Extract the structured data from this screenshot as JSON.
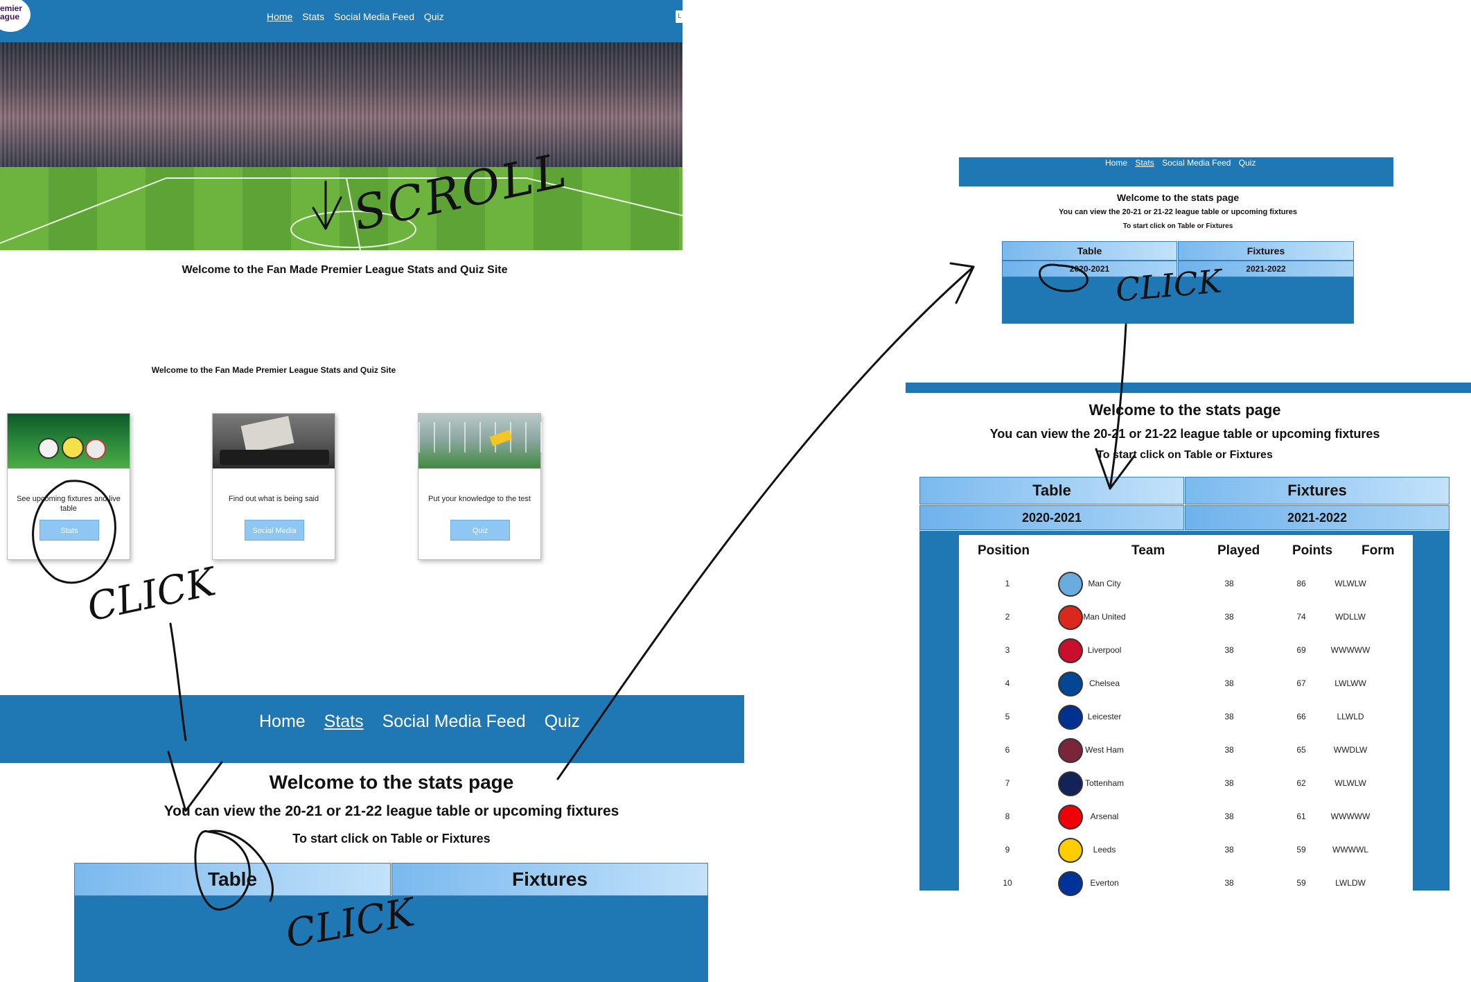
{
  "home_page": {
    "logo_text": "emier ague",
    "nav": [
      "Home",
      "Stats",
      "Social Media Feed",
      "Quiz"
    ],
    "nav_right_button": "L",
    "welcome_title": "Welcome to the Fan Made Premier League Stats and Quiz Site",
    "scroll_title": "Welcome to the Fan Made Premier League Stats and Quiz Site",
    "cards": [
      {
        "text": "See upcoming fixtures and live table",
        "button": "Stats"
      },
      {
        "text": "Find out what is being said",
        "button": "Social Media"
      },
      {
        "text": "Put your knowledge to the test",
        "button": "Quiz"
      }
    ]
  },
  "stats_page": {
    "nav": [
      "Home",
      "Stats",
      "Social Media Feed",
      "Quiz"
    ],
    "title": "Welcome to the stats page",
    "subtitle": "You can view the 20-21 or 21-22 league table or upcoming fixtures",
    "instruction": "To start click on Table or Fixtures",
    "tab_table": "Table",
    "tab_fixtures": "Fixtures",
    "season_a": "2020-2021",
    "season_b": "2021-2022"
  },
  "league_table": {
    "headers": [
      "Position",
      "Team",
      "Played",
      "Points",
      "Form"
    ],
    "rows": [
      {
        "pos": "1",
        "team": "Man City",
        "played": "38",
        "points": "86",
        "form": "WLWLW",
        "color": "#6cabdd"
      },
      {
        "pos": "2",
        "team": "Man United",
        "played": "38",
        "points": "74",
        "form": "WDLLW",
        "color": "#da291c"
      },
      {
        "pos": "3",
        "team": "Liverpool",
        "played": "38",
        "points": "69",
        "form": "WWWWW",
        "color": "#c8102e"
      },
      {
        "pos": "4",
        "team": "Chelsea",
        "played": "38",
        "points": "67",
        "form": "LWLWW",
        "color": "#034694"
      },
      {
        "pos": "5",
        "team": "Leicester",
        "played": "38",
        "points": "66",
        "form": "LLWLD",
        "color": "#003090"
      },
      {
        "pos": "6",
        "team": "West Ham",
        "played": "38",
        "points": "65",
        "form": "WWDLW",
        "color": "#7a263a"
      },
      {
        "pos": "7",
        "team": "Tottenham",
        "played": "38",
        "points": "62",
        "form": "WLWLW",
        "color": "#132257"
      },
      {
        "pos": "8",
        "team": "Arsenal",
        "played": "38",
        "points": "61",
        "form": "WWWWW",
        "color": "#ef0107"
      },
      {
        "pos": "9",
        "team": "Leeds",
        "played": "38",
        "points": "59",
        "form": "WWWWL",
        "color": "#ffcd00"
      },
      {
        "pos": "10",
        "team": "Everton",
        "played": "38",
        "points": "59",
        "form": "LWLDW",
        "color": "#003399"
      }
    ]
  },
  "annotations": {
    "scroll": "SCROLL",
    "click": "CLICK",
    "click_b": "CLICK",
    "click_c": "CLICK"
  },
  "colors": {
    "nav_blue": "#1f77b4",
    "button_light_blue": "#8ec6f4"
  }
}
